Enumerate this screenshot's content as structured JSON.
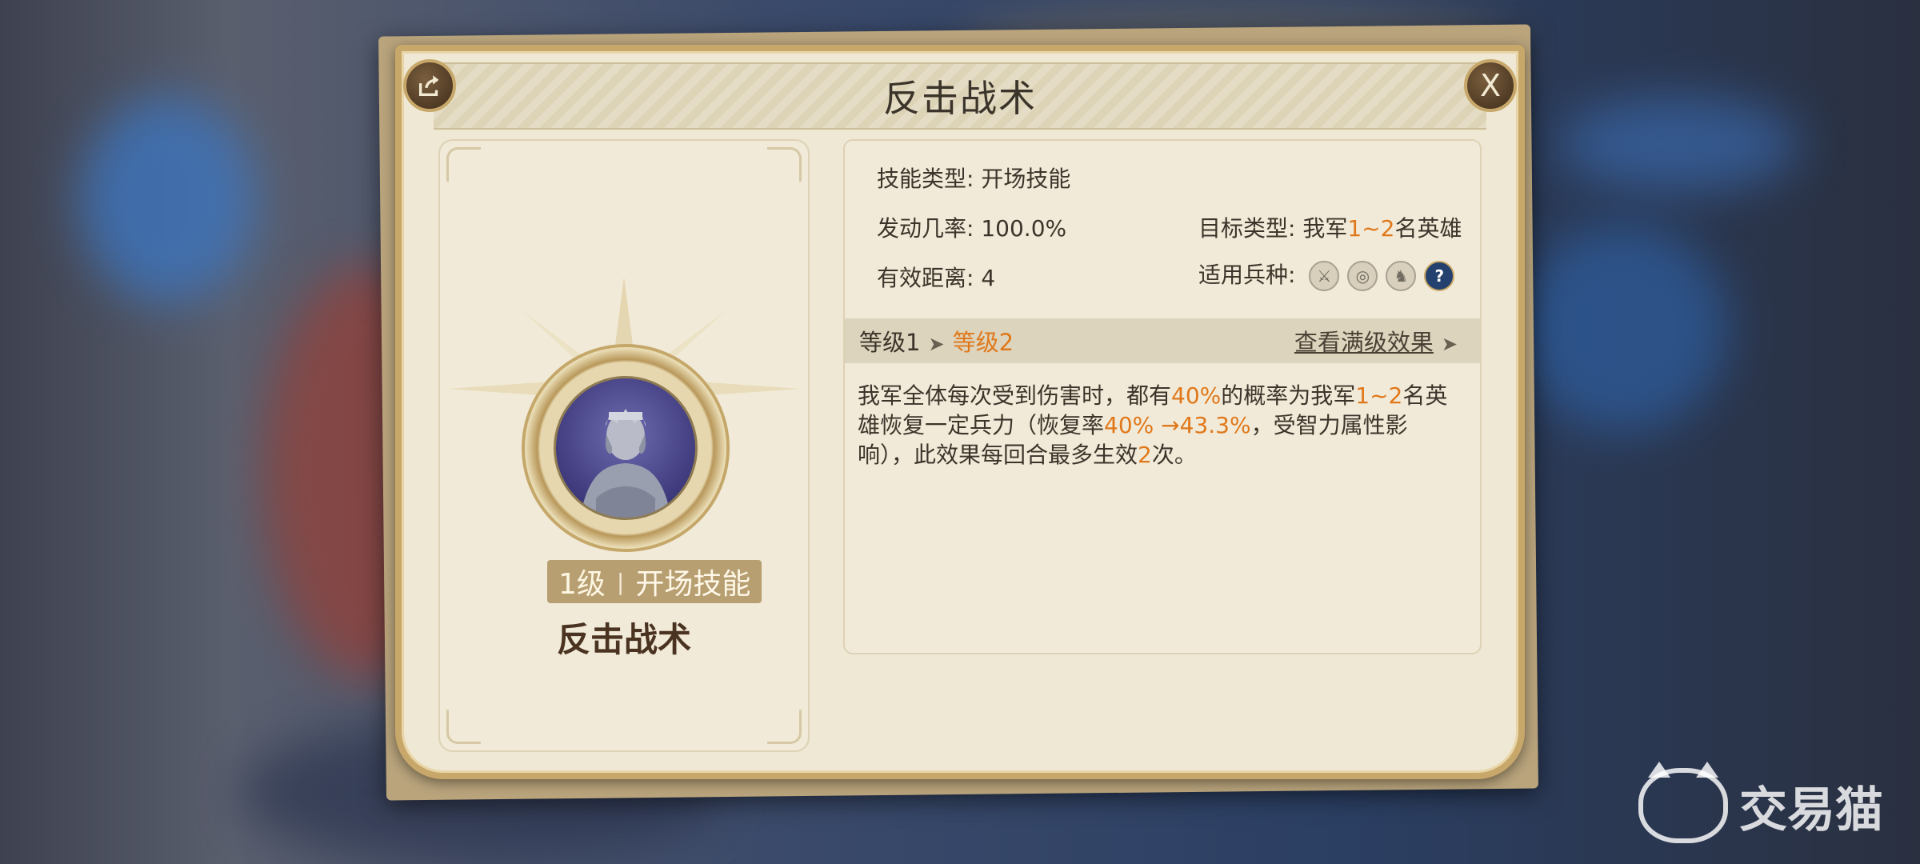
{
  "dialog": {
    "title": "反击战术",
    "share_icon": "share-icon",
    "close_label": "X"
  },
  "skill_card": {
    "level_text": "1级",
    "separator": "|",
    "type_text": "开场技能",
    "name": "反击战术"
  },
  "details": {
    "skill_type_label": "技能类型:",
    "skill_type_value": "开场技能",
    "trigger_rate_label": "发动几率:",
    "trigger_rate_value": "100.0%",
    "range_label": "有效距离:",
    "range_value": "4",
    "target_label": "目标类型:",
    "target_prefix": "我军",
    "target_range": "1~2",
    "target_suffix": "名英雄",
    "troops_label": "适用兵种:",
    "troop_icons": [
      "sword-icon",
      "target-icon",
      "horse-icon",
      "question-icon"
    ],
    "troop_glyphs": [
      "⚔",
      "◎",
      "♞",
      "?"
    ]
  },
  "level_bar": {
    "level1": "等级1",
    "arrow": "➤",
    "level2": "等级2",
    "full_effect": "查看满级效果",
    "full_effect_arrow": "➤"
  },
  "description": {
    "p1": "我军全体每次受到伤害时，都有",
    "v1": "40%",
    "p2": "的概率为我军",
    "v2": "1~2",
    "p3": "名英雄恢复一定兵力（恢复率",
    "v3": "40% →43.3%",
    "p4": "，受智力属性影响），此效果每回合最多生效",
    "v4": "2",
    "p5": "次。"
  },
  "watermark": {
    "text": "交易猫"
  },
  "colors": {
    "highlight": "#e0781a",
    "panel_bg": "#efe8d4",
    "frame": "#c8a86a"
  }
}
